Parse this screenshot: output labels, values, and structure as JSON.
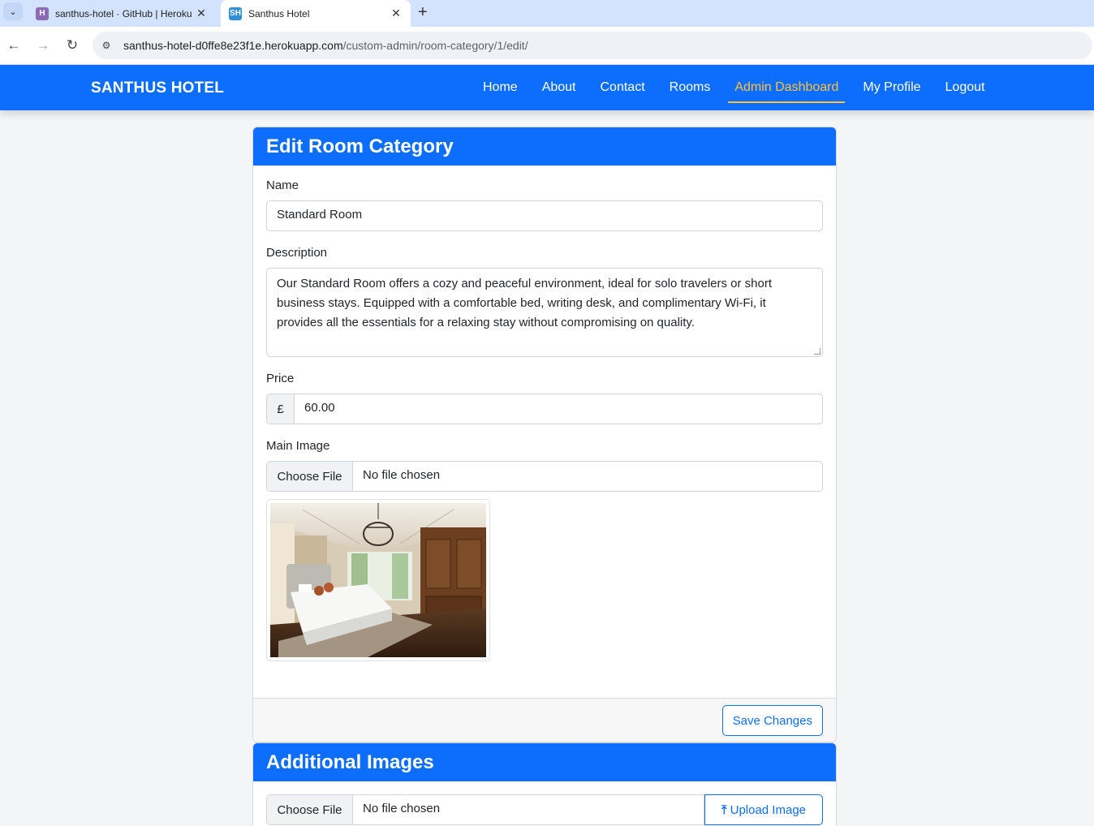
{
  "browser": {
    "tabs": [
      {
        "title": "santhus-hotel · GitHub | Heroku",
        "favicon": "H"
      },
      {
        "title": "Santhus Hotel",
        "favicon": "SH"
      }
    ],
    "url_host": "santhus-hotel-d0ffe8e23f1e.herokuapp.com",
    "url_path": "/custom-admin/room-category/1/edit/"
  },
  "navbar": {
    "brand": "SANTHUS HOTEL",
    "links": [
      "Home",
      "About",
      "Contact",
      "Rooms",
      "Admin Dashboard",
      "My Profile",
      "Logout"
    ],
    "active_link": "Admin Dashboard",
    "bg_color": "#0d6efd",
    "active_color": "#ffc13b"
  },
  "edit_card": {
    "title": "Edit Room Category",
    "name_label": "Name",
    "name_value": "Standard Room",
    "description_label": "Description",
    "description_value": "Our Standard Room offers a cozy and peaceful environment, ideal for solo travelers or short business stays. Equipped with a comfortable bed, writing desk, and complimentary Wi-Fi, it provides all the essentials for a relaxing stay without compromising on quality.",
    "price_label": "Price",
    "currency": "£",
    "price_value": "60.00",
    "image_label": "Main Image",
    "choose_file": "Choose File",
    "no_file": "No file chosen",
    "save_button": "Save Changes"
  },
  "images_card": {
    "title": "Additional Images",
    "choose_file": "Choose File",
    "no_file": "No file chosen",
    "upload_button": "Upload Image"
  }
}
